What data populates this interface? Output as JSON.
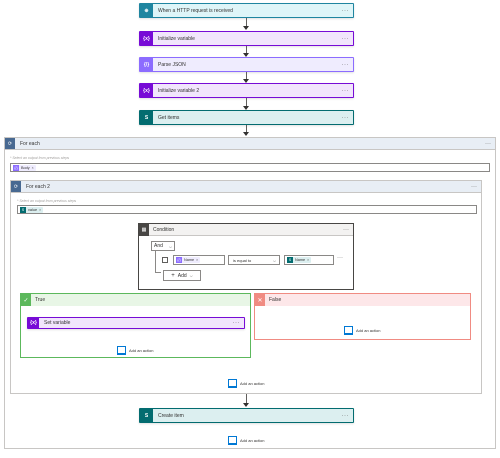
{
  "flow": {
    "trigger": {
      "label": "When a HTTP request is received",
      "icon": "globe-icon",
      "color": "#1f85a0",
      "bg": "#def5f8"
    },
    "init_var": {
      "label": "Initialize variable",
      "icon": "variable-icon",
      "color": "#770bd6",
      "bg": "#f1e5fc"
    },
    "parse_json": {
      "label": "Parse JSON",
      "icon": "data-operation-icon",
      "color": "#8c6cff",
      "bg": "#efecfe"
    },
    "init_var2": {
      "label": "Initialize variable 2",
      "icon": "variable-icon",
      "color": "#770bd6",
      "bg": "#f1e5fc"
    },
    "get_items": {
      "label": "Get items",
      "icon": "sharepoint-icon",
      "color": "#036c70",
      "bg": "#dceff0"
    },
    "create_item": {
      "label": "Create item",
      "icon": "sharepoint-icon",
      "color": "#036c70",
      "bg": "#dceff0"
    },
    "more": "···",
    "icon_glyphs": {
      "variable": "{x}",
      "data_op": "{/}",
      "sp": "S",
      "globe": "⊕",
      "foreach": "⟳",
      "cond": "▦",
      "check": "✓",
      "cross": "✕",
      "remove": "×"
    }
  },
  "for_each": {
    "label": "For each",
    "hint": "* Select an output from previous steps",
    "token": "Body"
  },
  "for_each_2": {
    "label": "For each 2",
    "hint": "* Select an output from previous steps",
    "token": "value"
  },
  "condition": {
    "label": "Condition",
    "operator": "And",
    "left_token": "Name",
    "comparison": "is equal to",
    "right_token": "Name",
    "add_label": "Add"
  },
  "true_branch": {
    "label": "True",
    "action": "Set variable",
    "add_action": "Add an action",
    "color": "#5cb85c",
    "bg": "#e8f6e6"
  },
  "false_branch": {
    "label": "False",
    "add_action": "Add an action",
    "color": "#f08b82",
    "bg": "#fde7e9"
  },
  "scope_add_action": "Add an action",
  "bottom_add_action": "Add an action"
}
